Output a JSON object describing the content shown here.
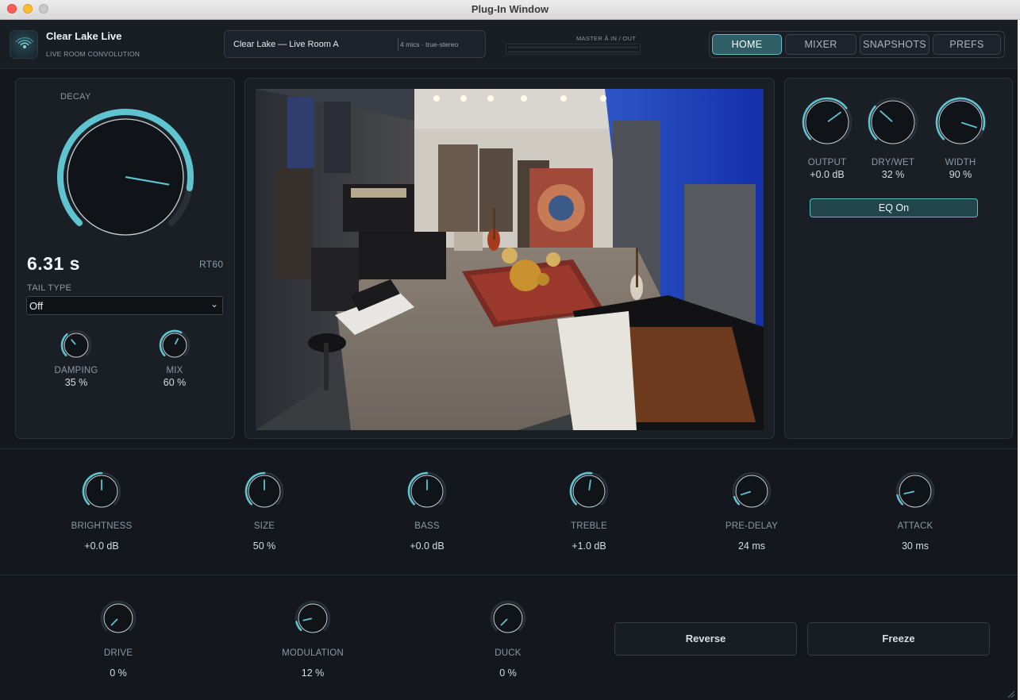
{
  "window": {
    "title": "Plug-In Window"
  },
  "app": {
    "name": "Clear Lake Live",
    "subtitle": "LIVE ROOM CONVOLUTION",
    "logo_icon": "radio-waves-icon"
  },
  "preset": {
    "name": "Clear Lake — Live Room A",
    "info": "4 mics · true-stereo"
  },
  "master": {
    "label": "MASTER  Ȃ  IN / OUT"
  },
  "nav": {
    "tabs": [
      {
        "label": "HOME",
        "active": true
      },
      {
        "label": "MIXER",
        "active": false
      },
      {
        "label": "SNAPSHOTS",
        "active": false
      },
      {
        "label": "PREFS",
        "active": false
      }
    ]
  },
  "decay": {
    "label": "DECAY",
    "value": "6.31 s",
    "unit_label": "RT60",
    "level": 0.87,
    "tail_type_label": "TAIL TYPE",
    "tail_type_value": "Off"
  },
  "left_knobs": [
    {
      "label": "DAMPING",
      "value": "35 %",
      "level": 0.35
    },
    {
      "label": "MIX",
      "value": "60 %",
      "level": 0.6
    }
  ],
  "right_knobs": [
    {
      "label": "OUTPUT",
      "value": "+0.0 dB",
      "level": 0.7
    },
    {
      "label": "DRY/WET",
      "value": "32 %",
      "level": 0.32
    },
    {
      "label": "WIDTH",
      "value": "90 %",
      "level": 0.9
    }
  ],
  "eq_button": {
    "label": "EQ On"
  },
  "row1_knobs": [
    {
      "label": "BRIGHTNESS",
      "value": "+0.0 dB",
      "level": 0.5
    },
    {
      "label": "SIZE",
      "value": "50 %",
      "level": 0.5
    },
    {
      "label": "BASS",
      "value": "+0.0 dB",
      "level": 0.5
    },
    {
      "label": "TREBLE",
      "value": "+1.0 dB",
      "level": 0.53
    },
    {
      "label": "PRE-DELAY",
      "value": "24 ms",
      "level": 0.1
    },
    {
      "label": "ATTACK",
      "value": "30 ms",
      "level": 0.12
    }
  ],
  "row2_knobs": [
    {
      "label": "DRIVE",
      "value": "0 %",
      "level": 0.0
    },
    {
      "label": "MODULATION",
      "value": "12 %",
      "level": 0.12
    },
    {
      "label": "DUCK",
      "value": "0 %",
      "level": 0.0
    }
  ],
  "buttons": {
    "reverse": "Reverse",
    "freeze": "Freeze"
  },
  "colors": {
    "accent": "#5ec4cf",
    "background": "#14181e",
    "panel": "#1a1f26",
    "track": "#2a3038"
  }
}
